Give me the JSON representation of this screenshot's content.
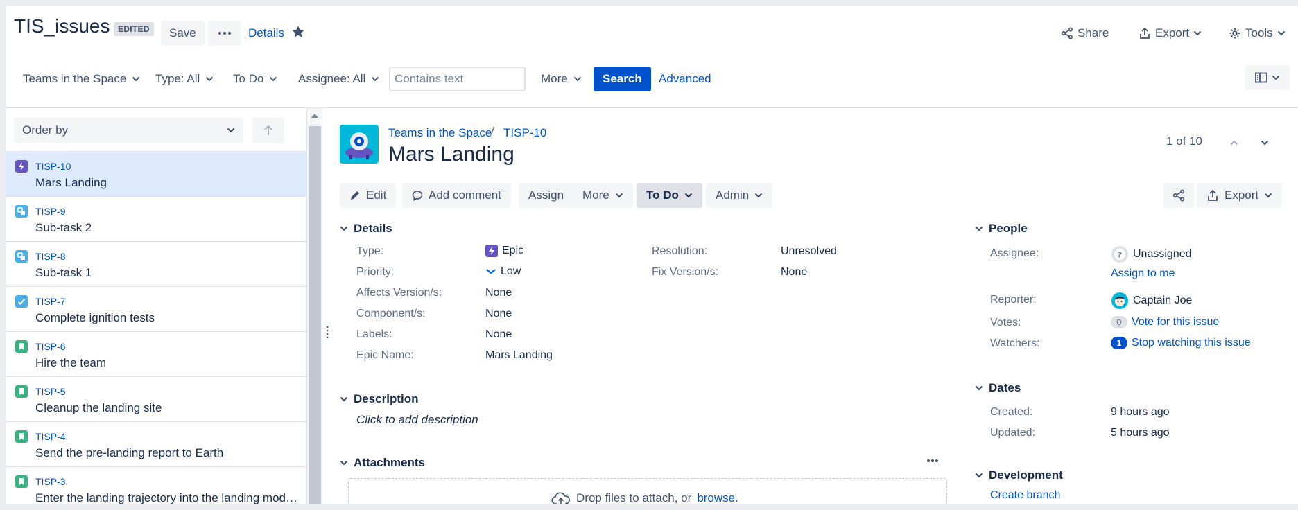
{
  "header": {
    "filter_name": "TIS_issues",
    "edited_badge": "EDITED",
    "save_label": "Save",
    "more_label": "···",
    "details_label": "Details",
    "share_label": "Share",
    "export_label": "Export",
    "tools_label": "Tools"
  },
  "filters": {
    "project": "Teams in the Space",
    "type": "Type: All",
    "status": "To Do",
    "assignee": "Assignee: All",
    "text_placeholder": "Contains text",
    "text_value": "",
    "more": "More",
    "search": "Search",
    "advanced": "Advanced"
  },
  "list": {
    "order_by": "Order by",
    "items": [
      {
        "key": "TISP-10",
        "summary": "Mars Landing",
        "type": "epic"
      },
      {
        "key": "TISP-9",
        "summary": "Sub-task 2",
        "type": "subtask"
      },
      {
        "key": "TISP-8",
        "summary": "Sub-task 1",
        "type": "subtask"
      },
      {
        "key": "TISP-7",
        "summary": "Complete ignition tests",
        "type": "task"
      },
      {
        "key": "TISP-6",
        "summary": "Hire the team",
        "type": "story"
      },
      {
        "key": "TISP-5",
        "summary": "Cleanup the landing site",
        "type": "story"
      },
      {
        "key": "TISP-4",
        "summary": "Send the pre-landing report to Earth",
        "type": "story"
      },
      {
        "key": "TISP-3",
        "summary": "Enter the landing trajectory into the landing module",
        "type": "story"
      }
    ]
  },
  "issue": {
    "project": "Teams in the Space",
    "separator": "/",
    "key": "TISP-10",
    "title": "Mars Landing",
    "pager": "1 of 10",
    "toolbar": {
      "edit": "Edit",
      "add_comment": "Add comment",
      "assign": "Assign",
      "more": "More",
      "status": "To Do",
      "admin": "Admin",
      "export": "Export"
    },
    "details": {
      "heading": "Details",
      "type_label": "Type:",
      "type_value": "Epic",
      "priority_label": "Priority:",
      "priority_value": "Low",
      "affects_label": "Affects Version/s:",
      "affects_value": "None",
      "component_label": "Component/s:",
      "component_value": "None",
      "labels_label": "Labels:",
      "labels_value": "None",
      "epic_name_label": "Epic Name:",
      "epic_name_value": "Mars Landing",
      "resolution_label": "Resolution:",
      "resolution_value": "Unresolved",
      "fix_label": "Fix Version/s:",
      "fix_value": "None"
    },
    "description": {
      "heading": "Description",
      "placeholder": "Click to add description"
    },
    "attachments": {
      "heading": "Attachments",
      "drop_text": "Drop files to attach, or",
      "browse": "browse."
    },
    "people": {
      "heading": "People",
      "assignee_label": "Assignee:",
      "assignee_value": "Unassigned",
      "assign_to_me": "Assign to me",
      "reporter_label": "Reporter:",
      "reporter_value": "Captain Joe",
      "votes_label": "Votes:",
      "votes_count": "0",
      "vote_link": "Vote for this issue",
      "watchers_label": "Watchers:",
      "watchers_count": "1",
      "watch_link": "Stop watching this issue"
    },
    "dates": {
      "heading": "Dates",
      "created_label": "Created:",
      "created_value": "9 hours ago",
      "updated_label": "Updated:",
      "updated_value": "5 hours ago"
    },
    "development": {
      "heading": "Development",
      "create_branch": "Create branch"
    }
  },
  "colors": {
    "primary": "#0052cc",
    "epic": "#6554c0",
    "subtask": "#4bade8",
    "task": "#4bade8",
    "story": "#36b37e",
    "selected_row": "#deebff"
  }
}
